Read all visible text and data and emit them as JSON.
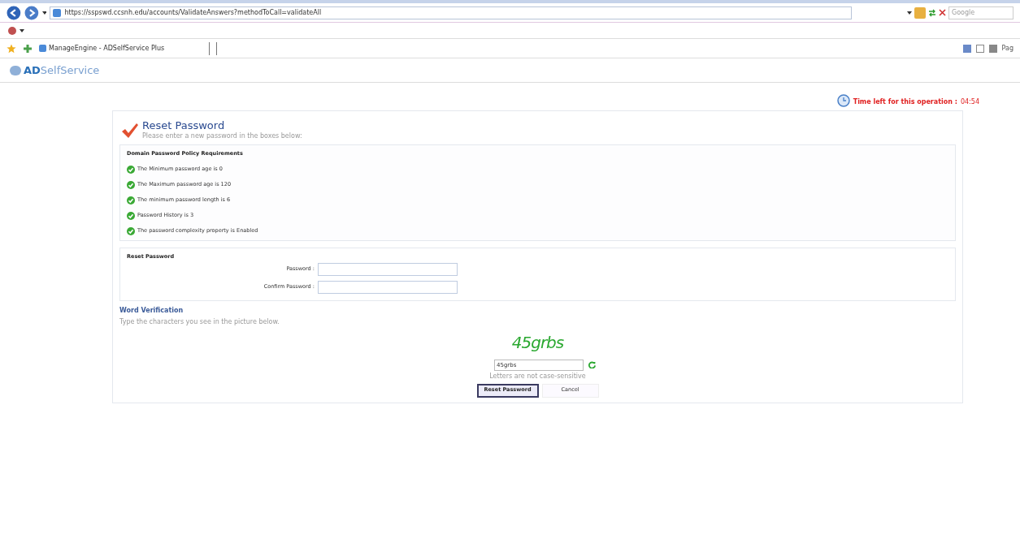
{
  "browser": {
    "url": "https://sspswd.ccsnh.edu/accounts/ValidateAnswers?methodToCall=validateAll",
    "search_placeholder": "Google",
    "tab_title": "ManageEngine - ADSelfService Plus",
    "toolbar_page": "Pag"
  },
  "logo": {
    "prefix": "AD",
    "name": "SelfService"
  },
  "timer": {
    "label": "Time left for this operation :",
    "value": "04:54"
  },
  "header": {
    "title": "Reset Password",
    "subtitle": "Please enter a new password in the boxes below:"
  },
  "policy": {
    "title": "Domain Password Policy Requirements",
    "items": [
      {
        "text": "The Minimum password age is 0",
        "met": true
      },
      {
        "text": "The Maximum password age is 120",
        "met": true
      },
      {
        "text": "The minimum password length is 6",
        "met": true
      },
      {
        "text": "Password History is 3",
        "met": true
      },
      {
        "text": "The password complexity property is Enabled",
        "met": true
      }
    ]
  },
  "reset": {
    "title": "Reset Password",
    "fields": [
      {
        "label": "Password :"
      },
      {
        "label": "Confirm Password :"
      }
    ]
  },
  "verification": {
    "title": "Word Verification",
    "hint": "Type the characters you see in the picture below.",
    "captcha": "45grbs",
    "value": "45grbs",
    "note": "Letters are not case-sensitive"
  },
  "buttons": [
    {
      "label": "Reset Password",
      "primary": true
    },
    {
      "label": "Cancel",
      "primary": false
    }
  ]
}
